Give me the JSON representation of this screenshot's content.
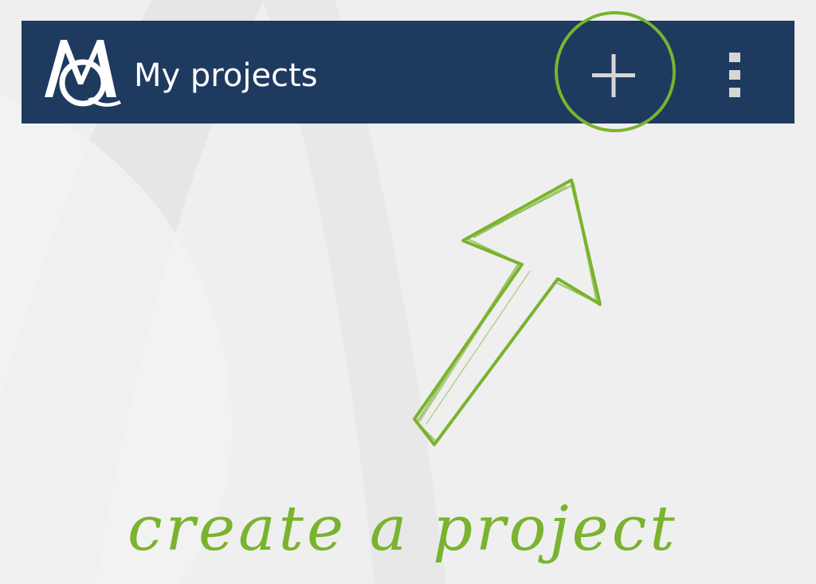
{
  "header": {
    "app_logo": "maxqda-logo",
    "title": "My projects",
    "add_icon": "plus-icon",
    "overflow_icon": "more-vertical-icon"
  },
  "hint": {
    "caption": "create a project",
    "highlight_color": "#7ab32e",
    "arrow_icon": "sketch-arrow-icon"
  },
  "colors": {
    "action_bar": "#1e3a5f",
    "background": "#efefef",
    "icon": "#d6d6d6",
    "hint": "#7ab32e"
  }
}
